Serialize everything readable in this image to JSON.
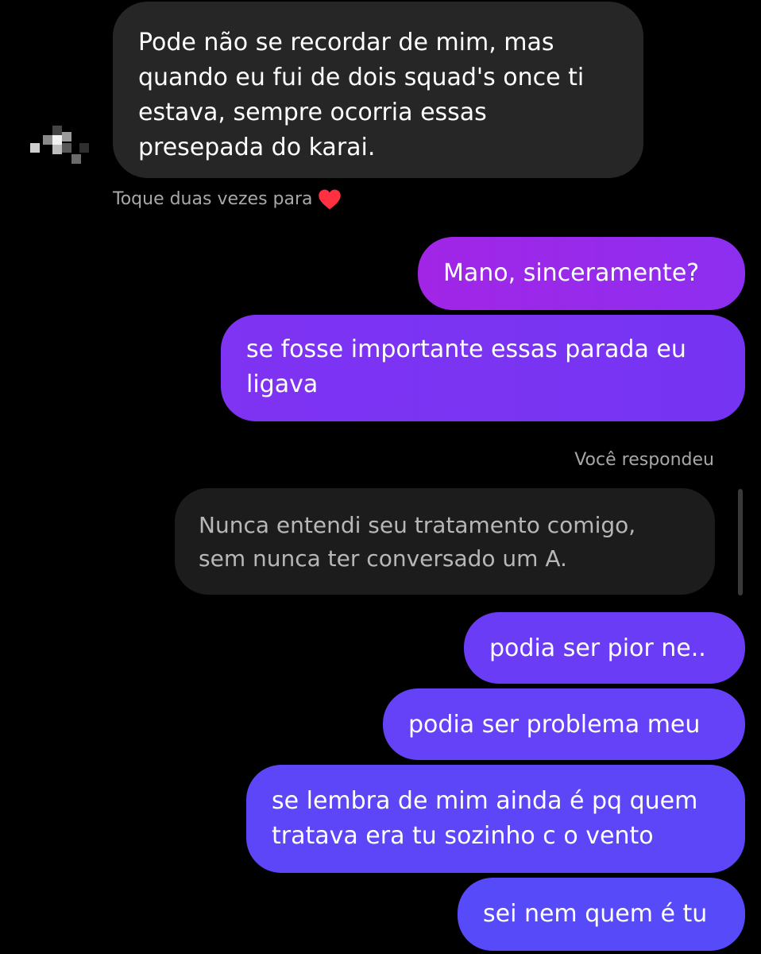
{
  "conversation": {
    "incoming_message": "Pode não se recordar de mim, mas\nquando eu fui de dois squad's once ti\nestava, sempre ocorria essas\npresepada do karai.",
    "double_tap_hint": "Toque duas vezes para",
    "reply_label": "Você respondeu",
    "quoted_message": "Nunca entendi seu tratamento comigo,\nsem nunca ter conversado um A.",
    "sent_messages": [
      "Mano, sinceramente?",
      "se fosse importante essas parada eu\nligava",
      "podia ser pior ne..",
      "podia ser problema meu",
      "se lembra de mim ainda é pq quem\ntratava era tu sozinho c o vento",
      "sei nem quem é tu"
    ]
  },
  "colors": {
    "incoming_bubble": "#262626",
    "quoted_bubble": "#1c1c1c",
    "outgoing_bubble_top": "#a225e6",
    "outgoing_bubble_bottom": "#574af8",
    "heart": "#ff3040"
  },
  "icons": {
    "avatar": "pixelated-avatar-icon",
    "heart": "heart-icon"
  }
}
